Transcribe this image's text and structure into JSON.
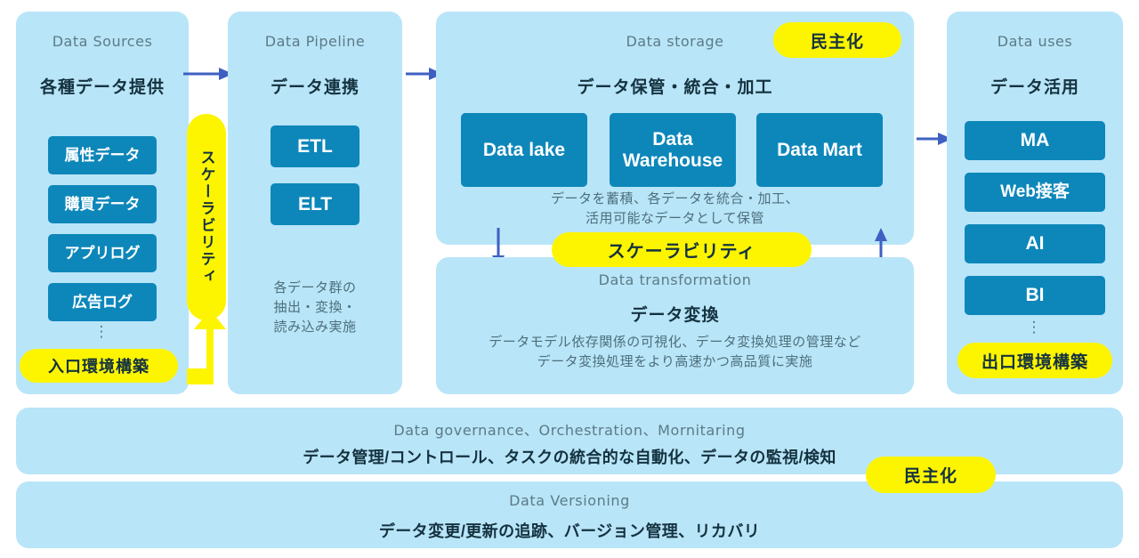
{
  "colors": {
    "panel_bg": "#b9e5f8",
    "chip_blue": "#0d87ba",
    "pill_yellow": "#fdf500",
    "arrow_blue": "#3e60c1",
    "eyebrow_text": "#5b7b86",
    "headline_text": "#14323f",
    "page_bg": "#ffffff"
  },
  "columns": {
    "data_sources": {
      "eyebrow": "Data Sources",
      "headline": "各種データ提供",
      "chips": [
        {
          "label": "属性データ"
        },
        {
          "label": "購買データ"
        },
        {
          "label": "アプリログ"
        },
        {
          "label": "広告ログ"
        }
      ],
      "ellipsis": "⋮",
      "badge": "入口環境構築"
    },
    "data_pipeline": {
      "eyebrow": "Data Pipeline",
      "headline": "データ連携",
      "chips": [
        {
          "label": "ETL"
        },
        {
          "label": "ELT"
        }
      ],
      "note": "各データ群の\n抽出・変換・\n読み込み実施"
    },
    "data_storage": {
      "eyebrow": "Data storage",
      "headline": "データ保管・統合・加工",
      "badge": "民主化",
      "chips": [
        {
          "label": "Data lake"
        },
        {
          "label": "Data\nWarehouse"
        },
        {
          "label": "Data Mart"
        }
      ],
      "note": "データを蓄積、各データを統合・加工、\n活用可能なデータとして保管"
    },
    "data_transformation": {
      "eyebrow": "Data transformation",
      "headline": "データ変換",
      "note": "データモデル依存関係の可視化、データ変換処理の管理など\nデータ変換処理をより高速かつ高品質に実施",
      "badge": "スケーラビリティ"
    },
    "data_uses": {
      "eyebrow": "Data uses",
      "headline": "データ活用",
      "chips": [
        {
          "label": "MA"
        },
        {
          "label": "Web接客"
        },
        {
          "label": "AI"
        },
        {
          "label": "BI"
        }
      ],
      "ellipsis": "⋮",
      "badge": "出口環境構築"
    }
  },
  "scalability_pill_vertical": "スケーラビリティ",
  "bands": [
    {
      "eyebrow": "Data governance、Orchestration、Mornitaring",
      "headline": "データ管理/コントロール、タスクの統合的な自動化、データの監視/検知"
    },
    {
      "eyebrow": "Data Versioning",
      "headline": "データ変更/更新の追跡、バージョン管理、リカバリ"
    }
  ],
  "bands_badge": "民主化"
}
